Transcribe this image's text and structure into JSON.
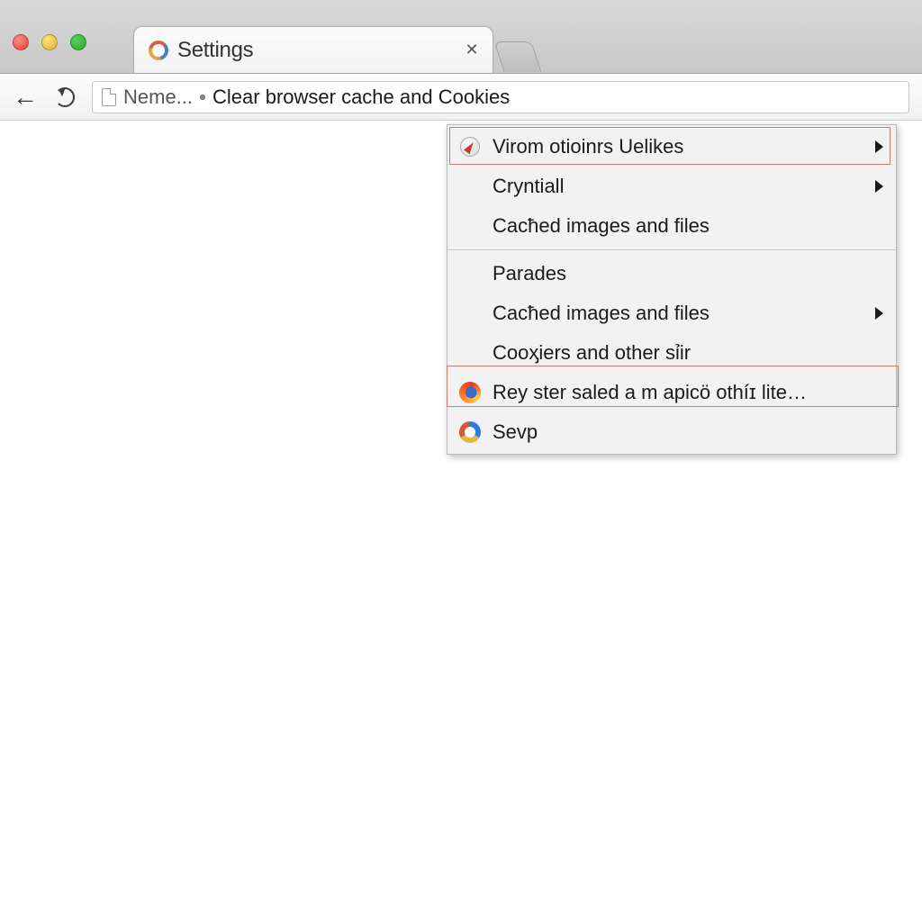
{
  "window": {
    "tab_title": "Settings"
  },
  "toolbar": {
    "omnibox_prefix": "Neme...",
    "omnibox_text": "Clear browser cache and Cookies"
  },
  "menu": {
    "items": [
      {
        "label": "Virom otioinrs Uelikes",
        "icon": "compass-icon",
        "submenu": true,
        "highlighted": true
      },
      {
        "label": "Cryntiall",
        "icon": null,
        "submenu": true,
        "highlighted": false
      },
      {
        "label": "Cacħed images and files",
        "icon": null,
        "submenu": false,
        "highlighted": false
      }
    ],
    "items2": [
      {
        "label": "Parades",
        "icon": null,
        "submenu": false,
        "highlighted": false
      },
      {
        "label": "Cacħed images and files",
        "icon": null,
        "submenu": true,
        "highlighted": false
      },
      {
        "label": "Cooᶍiers and other sỉir",
        "icon": null,
        "submenu": false,
        "highlighted": false
      },
      {
        "label": "Rey ster saled a m apicö othíɪ lite…",
        "icon": "firefox-icon",
        "submenu": false,
        "highlighted": true
      },
      {
        "label": "Sevp",
        "icon": "chrome-like-icon",
        "submenu": false,
        "highlighted": false
      }
    ]
  }
}
